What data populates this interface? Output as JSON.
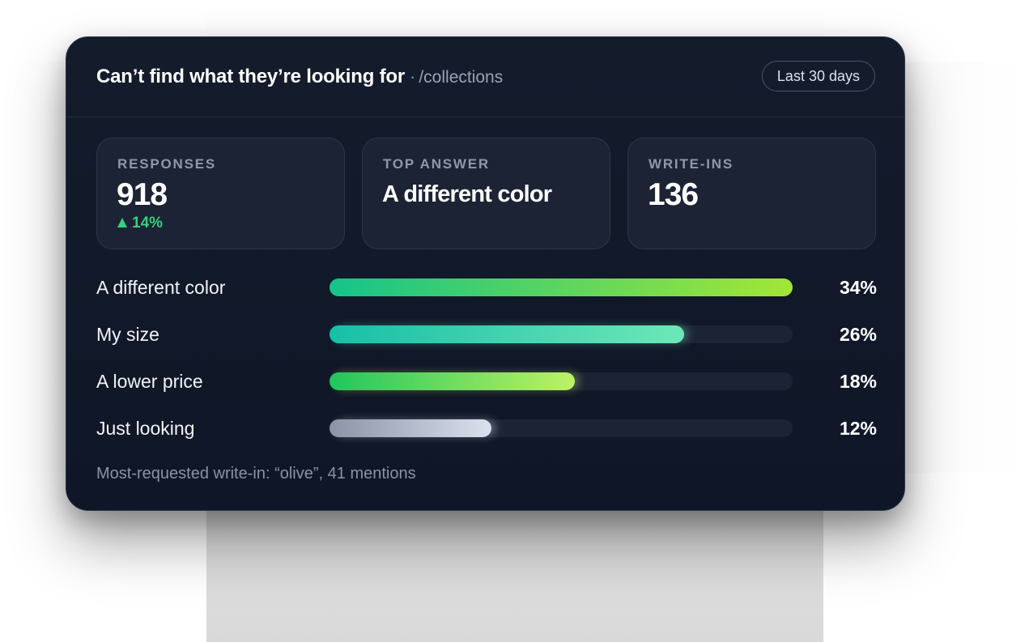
{
  "header": {
    "title": "Can’t find what they’re looking for",
    "separator": "·",
    "path": "/collections",
    "range_label": "Last 30 days"
  },
  "stats": {
    "responses": {
      "label": "RESPONSES",
      "value": "918",
      "delta": "14%",
      "delta_direction": "up",
      "delta_color": "#35d07f"
    },
    "top_answer": {
      "label": "TOP ANSWER",
      "value": "A different color"
    },
    "write_ins": {
      "label": "WRITE-INS",
      "value": "136"
    }
  },
  "answers": [
    {
      "label": "A different color",
      "pct_text": "34%",
      "fill_fraction": 1.0,
      "gradient": [
        "#14c48a",
        "#a3e635"
      ]
    },
    {
      "label": "My size",
      "pct_text": "26%",
      "fill_fraction": 0.765,
      "gradient": [
        "#17bfa8",
        "#6ee7b7"
      ]
    },
    {
      "label": "A lower price",
      "pct_text": "18%",
      "fill_fraction": 0.53,
      "gradient": [
        "#22c55e",
        "#bef264"
      ]
    },
    {
      "label": "Just looking",
      "pct_text": "12%",
      "fill_fraction": 0.35,
      "gradient": [
        "#8b93a7",
        "#dbe1ee"
      ]
    }
  ],
  "footnote": "Most-requested write-in: “olive”, 41 mentions",
  "colors": {
    "card_bg": "#141c2c",
    "stat_card_bg": "#1c2335",
    "track_bg": "#1c2335",
    "accent_green": "#35d07f"
  }
}
